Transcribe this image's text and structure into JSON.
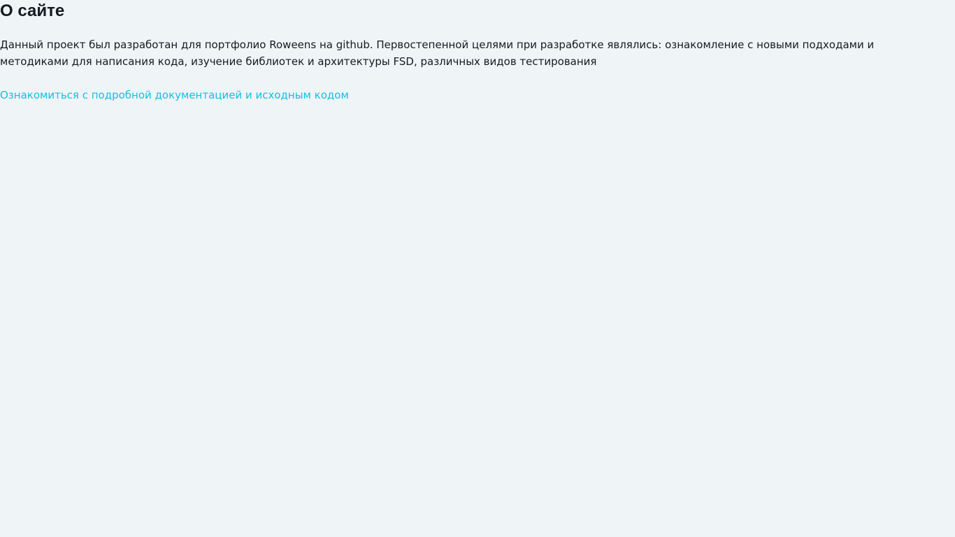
{
  "about": {
    "title": "О сайте",
    "description": "Данный проект был разработан для портфолио Roweens на github. Первостепенной целями при разработке являлись: ознакомление с новыми подходами и методиками для написания кода, изучение библиотек и архитектуры FSD, различных видов тестирования",
    "docs_link_label": "Ознакомиться с подробной документацией и исходным кодом"
  },
  "colors": {
    "background": "#eff4f7",
    "text": "#161b22",
    "link": "#13c0e0"
  }
}
